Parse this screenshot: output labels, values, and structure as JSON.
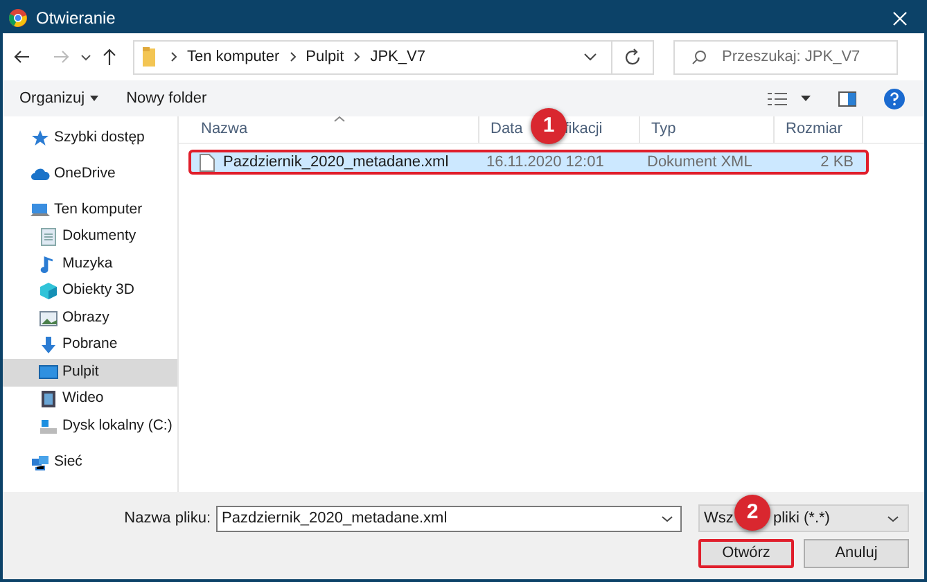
{
  "window": {
    "title": "Otwieranie"
  },
  "address": {
    "path": [
      "Ten komputer",
      "Pulpit",
      "JPK_V7"
    ]
  },
  "search": {
    "placeholder": "Przeszukaj: JPK_V7"
  },
  "toolbar": {
    "buttons": [
      {
        "label": "Organizuj",
        "dropdown": true
      },
      {
        "label": "Nowy folder",
        "dropdown": false
      }
    ]
  },
  "sidebar": {
    "items": [
      {
        "label": "Szybki dostęp",
        "selected": false
      },
      {
        "label": "OneDrive",
        "selected": false
      },
      {
        "label": "Ten komputer",
        "selected": false,
        "children": [
          {
            "label": "Dokumenty",
            "selected": false
          },
          {
            "label": "Muzyka",
            "selected": false
          },
          {
            "label": "Obiekty 3D",
            "selected": false
          },
          {
            "label": "Obrazy",
            "selected": false
          },
          {
            "label": "Pobrane",
            "selected": false
          },
          {
            "label": "Pulpit",
            "selected": true
          },
          {
            "label": "Wideo",
            "selected": false
          },
          {
            "label": "Dysk lokalny (C:)",
            "selected": false
          }
        ]
      },
      {
        "label": "Sieć",
        "selected": false
      }
    ]
  },
  "table": {
    "columns": [
      {
        "label": "Nazwa"
      },
      {
        "label": "Data",
        "label_tail": "fikacji"
      },
      {
        "label": "Typ"
      },
      {
        "label": "Rozmiar"
      }
    ],
    "rows": [
      {
        "cells": [
          "Pazdziernik_2020_metadane.xml",
          "16.11.2020 12:01",
          "Dokument XML",
          "2 KB"
        ],
        "selected": true
      }
    ]
  },
  "footer": {
    "filename_label": "Nazwa pliku:",
    "filename": "Pazdziernik_2020_metadane.xml",
    "filter": "Wsz",
    "filter_tail": "pliki (*.*)",
    "buttons": [
      {
        "label": "Otwórz",
        "kind": "primary"
      },
      {
        "label": "Anuluj",
        "kind": "secondary"
      }
    ]
  },
  "callouts": [
    "1",
    "2"
  ]
}
